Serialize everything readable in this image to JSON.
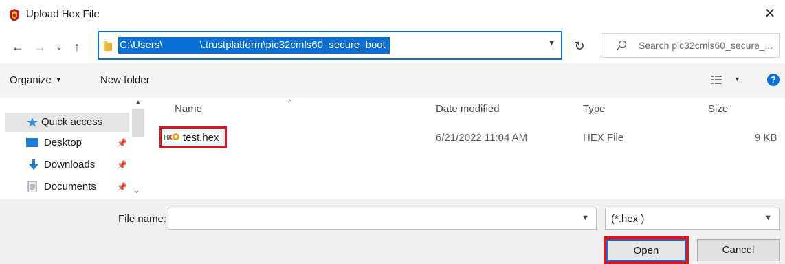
{
  "window": {
    "title": "Upload Hex File",
    "close_glyph": "✕",
    "icon": "shield-app-icon"
  },
  "address": {
    "path": "C:\\Users\\             \\.trustplatform\\pic32cmls60_secure_boot",
    "refresh_glyph": "↻",
    "search_placeholder": "Search pic32cmls60_secure_..."
  },
  "nav_buttons": {
    "back": "←",
    "forward": "→",
    "recent": "⌄",
    "up": "↑"
  },
  "toolbar": {
    "organize": "Organize",
    "new_folder": "New folder",
    "help": "?"
  },
  "sidebar": {
    "items": [
      {
        "label": "Quick access",
        "icon": "star-icon",
        "selected": true,
        "pinned": false
      },
      {
        "label": "Desktop",
        "icon": "desktop-icon",
        "pinned": true
      },
      {
        "label": "Downloads",
        "icon": "download-arrow-icon",
        "pinned": true
      },
      {
        "label": "Documents",
        "icon": "document-icon",
        "pinned": true
      }
    ]
  },
  "file_list": {
    "columns": [
      "Name",
      "Date modified",
      "Type",
      "Size"
    ],
    "rows": [
      {
        "name": "test.hex",
        "date": "6/21/2022 11:04 AM",
        "type": "HEX File",
        "size": "9 KB"
      }
    ]
  },
  "footer": {
    "file_name_label": "File name:",
    "file_name_value": "",
    "file_type": "(*.hex )",
    "open_label": "Open",
    "cancel_label": "Cancel"
  },
  "colors": {
    "accent": "#0a6fd6",
    "highlight": "#e0141e"
  }
}
